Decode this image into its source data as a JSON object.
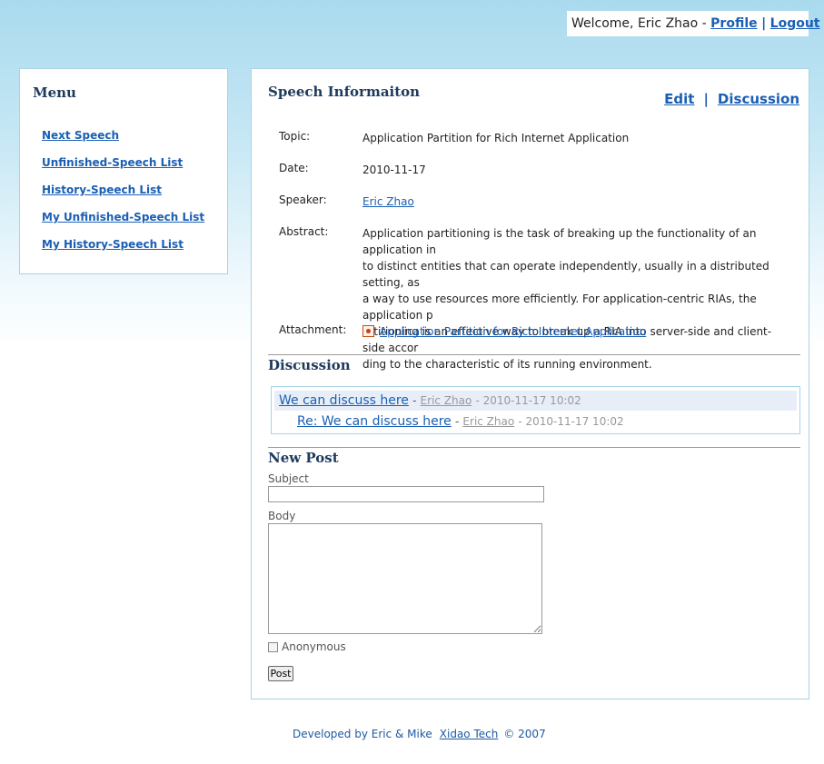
{
  "header": {
    "welcome": "Welcome, Eric Zhao  -",
    "profile": "Profile",
    "separator": "|",
    "logout": "Logout"
  },
  "menu": {
    "title": "Menu",
    "items": [
      {
        "label": "Next Speech"
      },
      {
        "label": "Unfinished-Speech List"
      },
      {
        "label": "History-Speech List"
      },
      {
        "label": "My Unfinished-Speech List"
      },
      {
        "label": "My History-Speech List"
      }
    ]
  },
  "speech": {
    "title": "Speech Informaiton",
    "edit": "Edit",
    "separator": "|",
    "discussion_link": "Discussion",
    "topic_label": "Topic:",
    "topic": "Application Partition for Rich Internet Application",
    "date_label": "Date:",
    "date": "2010-11-17",
    "speaker_label": "Speaker:",
    "speaker": "Eric Zhao",
    "abstract_label": "Abstract:",
    "abstract_lines": [
      "Application partitioning is the task of breaking up the functionality of an application in",
      "to distinct entities that can operate independently, usually in a distributed setting, as",
      "a way to use resources more efficiently. For application-centric RIAs, the application p",
      "artitioning is an effective way to break up a RIA into server-side and client-side accor",
      "ding to the characteristic of its running environment."
    ],
    "attachment_label": "Attachment:",
    "attachment": "Application Partition for Rich Internet Application"
  },
  "discussion": {
    "title": "Discussion",
    "posts": [
      {
        "subject": "We can discuss here",
        "dash": "-",
        "author": "Eric Zhao",
        "time": "- 2010-11-17 10:02"
      },
      {
        "subject": "Re: We can discuss here",
        "dash": "-",
        "author": "Eric Zhao",
        "time": "- 2010-11-17 10:02"
      }
    ]
  },
  "new_post": {
    "title": "New Post",
    "subject_label": "Subject",
    "subject_value": "",
    "body_label": "Body",
    "body_value": "",
    "anonymous_label": "Anonymous",
    "post_button": "Post"
  },
  "footer": {
    "developed_by": "Developed by Eric & Mike",
    "company": "Xidao Tech",
    "copyright": "© 2007"
  }
}
